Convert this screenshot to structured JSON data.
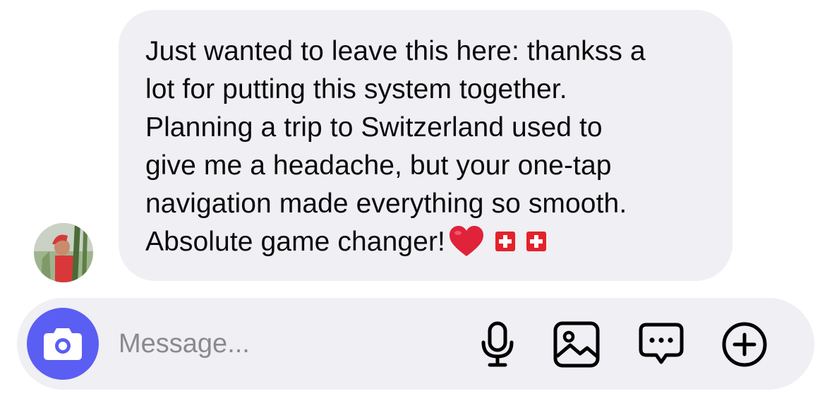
{
  "thread": {
    "received_message": {
      "text": "Just wanted to leave this here: thankss a\nlot for putting this system together.\nPlanning a trip to Switzerland used to\ngive me a headache, but your one-tap\nnavigation made everything so smooth.\nAbsolute game changer!",
      "emojis": [
        "red-heart",
        "swiss-flag",
        "swiss-flag"
      ]
    },
    "sender_avatar": "profile-photo"
  },
  "composer": {
    "placeholder": "Message...",
    "value": "",
    "icons": [
      "camera-icon",
      "microphone-icon",
      "gallery-icon",
      "chat-bubble-icon",
      "plus-circle-icon"
    ]
  },
  "colors": {
    "bubble_bg": "#efeff4",
    "composer_bg": "#efeff4",
    "camera_accent": "#5b5ef2",
    "text": "#0a0a0a",
    "placeholder": "#8a8a8e",
    "heart": "#e0223a",
    "swiss_red": "#e4222b"
  }
}
